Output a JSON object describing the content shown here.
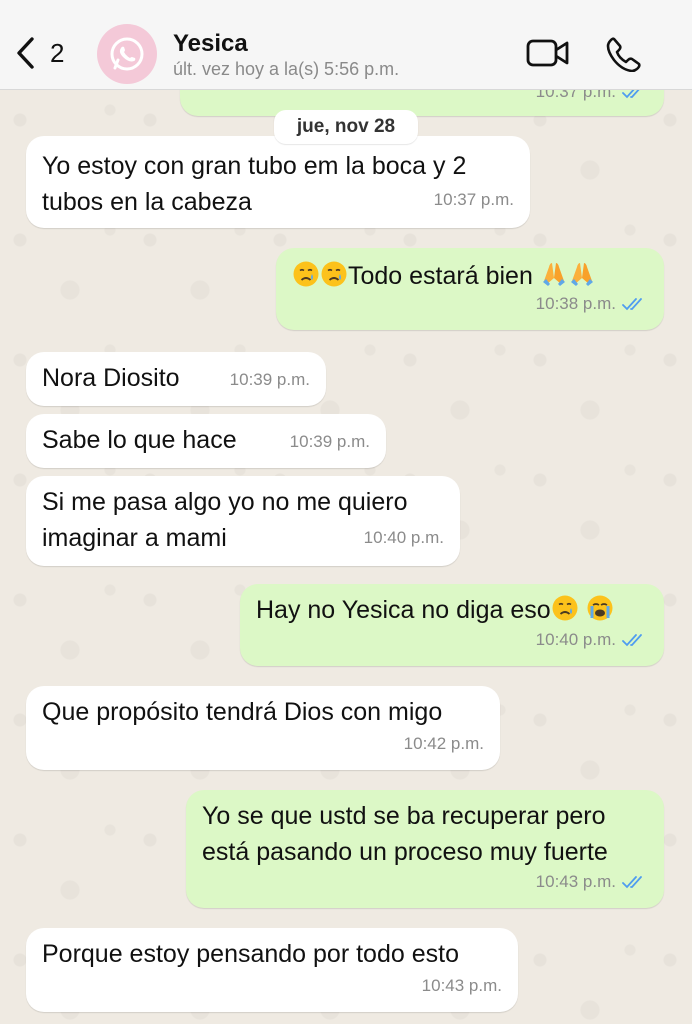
{
  "header": {
    "unread_count": "2",
    "contact_name": "Yesica",
    "status": "últ. vez hoy a la(s) 5:56 p.m."
  },
  "date_separator": "jue, nov 28",
  "messages": [
    {
      "dir": "out",
      "text": "",
      "time": "10:37 p.m."
    },
    {
      "dir": "in",
      "lines": [
        "Yo estoy con gran tubo em la boca y 2",
        "tubos en la cabeza"
      ],
      "time": "10:37 p.m."
    },
    {
      "dir": "out",
      "text": "Todo estará bien",
      "time": "10:38 p.m."
    },
    {
      "dir": "in",
      "text": "Nora Diosito",
      "time": "10:39 p.m."
    },
    {
      "dir": "in",
      "text": "Sabe lo que hace",
      "time": "10:39 p.m."
    },
    {
      "dir": "in",
      "lines": [
        "Si me pasa algo yo no me quiero",
        "imaginar a mami"
      ],
      "time": "10:40 p.m."
    },
    {
      "dir": "out",
      "text": "Hay no Yesica no diga eso",
      "time": "10:40 p.m."
    },
    {
      "dir": "in",
      "text": "Que propósito tendrá Dios con migo",
      "time": "10:42 p.m."
    },
    {
      "dir": "out",
      "lines": [
        "Yo se que ustd se ba recuperar pero",
        "está pasando un proceso muy fuerte"
      ],
      "time": "10:43 p.m."
    },
    {
      "dir": "in",
      "text": "Porque estoy pensando por todo esto",
      "time": "10:43 p.m."
    }
  ],
  "colors": {
    "incoming_bubble": "#ffffff",
    "outgoing_bubble": "#dcf8c6",
    "read_ticks": "#4f9cf0",
    "accent": "#111111"
  },
  "icons": [
    "chevron-left-icon",
    "video-call-icon",
    "phone-icon",
    "whatsapp-avatar-icon",
    "crying-face-emoji",
    "loudly-crying-face-emoji",
    "folded-hands-emoji"
  ]
}
